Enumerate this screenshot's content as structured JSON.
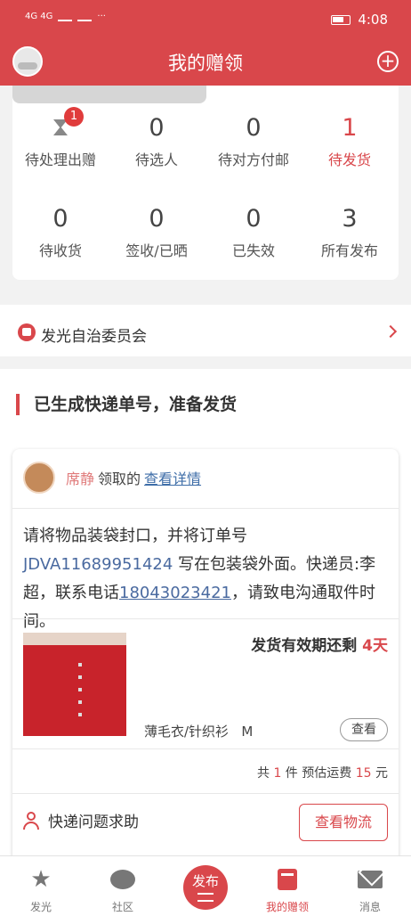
{
  "status_bar": {
    "time": "4:08",
    "left_text": "4G 4G",
    "more": "···"
  },
  "header": {
    "title": "我的赠领",
    "plus": "+"
  },
  "stats": [
    {
      "value": "0",
      "label": "待选人"
    },
    {
      "value": "0",
      "label": "待对方付邮"
    },
    {
      "value": "1",
      "label": "待发货"
    },
    {
      "value": "0",
      "label": "待收货"
    },
    {
      "value": "0",
      "label": "签收/已晒"
    },
    {
      "value": "0",
      "label": "已失效"
    },
    {
      "value": "3",
      "label": "所有发布"
    }
  ],
  "pending": {
    "label": "待处理出赠",
    "badge": "1"
  },
  "committee": {
    "label": "发光自治委员会"
  },
  "section": {
    "title": "已生成快递单号，准备发货"
  },
  "order": {
    "user_name": "席静",
    "action": "领取的",
    "detail_link": "查看详情",
    "instruction_prefix": "请将物品装袋封口，并将订单号 ",
    "order_number": "JDVA11689951424",
    "instruction_middle": " 写在包装袋外面。快递员:李超，联系电话",
    "phone": "18043023421",
    "instruction_suffix": "，请致电沟通取件时间。",
    "deadline_prefix": "发货有效期还剩 ",
    "deadline_days": "4天",
    "product_name": "薄毛衣/针织衫",
    "product_size": "M",
    "view_label": "查看",
    "summary_prefix": "共 ",
    "item_count": "1",
    "summary_middle": " 件 预估运费 ",
    "shipping_fee": "15",
    "summary_suffix": " 元",
    "help_label": "快递问题求助",
    "logistics_label": "查看物流"
  },
  "tabs": [
    {
      "label": "发光",
      "icon": "star-icon"
    },
    {
      "label": "社区",
      "icon": "chat-icon"
    },
    {
      "label": "发布",
      "icon": "publish-icon"
    },
    {
      "label": "我的赠领",
      "icon": "gift-book-icon"
    },
    {
      "label": "消息",
      "icon": "mail-icon"
    }
  ]
}
